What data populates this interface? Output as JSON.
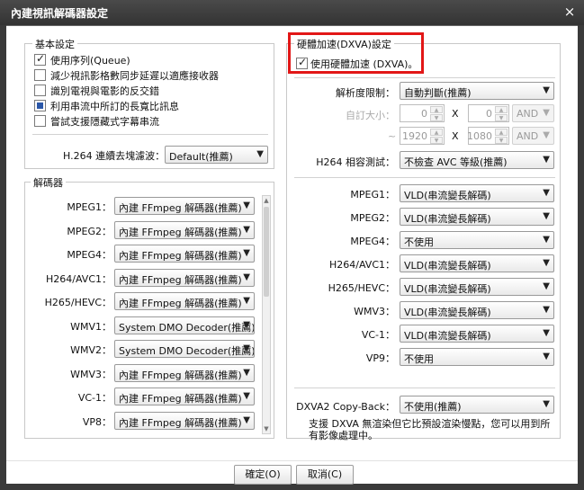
{
  "window": {
    "title": "內建視訊解碼器設定",
    "close_glyph": "×"
  },
  "basic": {
    "legend": "基本設定",
    "items": [
      {
        "label": "使用序列(Queue)",
        "state": "checked"
      },
      {
        "label": "減少視訊影格數同步延遲以適應接收器",
        "state": "unchecked"
      },
      {
        "label": "識別電視與電影的反交錯",
        "state": "unchecked"
      },
      {
        "label": "利用串流中所訂的長寬比訊息",
        "state": "indeterminate"
      },
      {
        "label": "嘗試支援隱藏式字幕串流",
        "state": "unchecked"
      }
    ],
    "deblock_label": "H.264 連續去塊濾波：",
    "deblock_value": "Default(推薦)"
  },
  "decoder": {
    "legend": "解碼器",
    "rows": [
      {
        "label": "MPEG1：",
        "value": "內建 FFmpeg 解碼器(推薦)"
      },
      {
        "label": "MPEG2：",
        "value": "內建 FFmpeg 解碼器(推薦)"
      },
      {
        "label": "MPEG4：",
        "value": "內建 FFmpeg 解碼器(推薦)"
      },
      {
        "label": "H264/AVC1：",
        "value": "內建 FFmpeg 解碼器(推薦)"
      },
      {
        "label": "H265/HEVC：",
        "value": "內建 FFmpeg 解碼器(推薦)"
      },
      {
        "label": "WMV1：",
        "value": "System DMO Decoder(推薦)"
      },
      {
        "label": "WMV2：",
        "value": "System DMO Decoder(推薦)"
      },
      {
        "label": "WMV3：",
        "value": "內建 FFmpeg 解碼器(推薦)"
      },
      {
        "label": "VC-1：",
        "value": "內建 FFmpeg 解碼器(推薦)"
      },
      {
        "label": "VP8：",
        "value": "內建 FFmpeg 解碼器(推薦)"
      }
    ]
  },
  "dxva": {
    "legend": "硬體加速(DXVA)設定",
    "enable_label": "使用硬體加速 (DXVA)。",
    "resolution_label": "解析度限制：",
    "resolution_value": "自動判斷(推薦)",
    "custom_size_label": "自訂大小：",
    "min_w": "0",
    "min_h": "0",
    "min_op": "AND",
    "tilde": "~",
    "max_w": "1920",
    "max_h": "1080",
    "max_op": "AND",
    "x_sep": "X",
    "compat_label": "H264 相容測試：",
    "compat_value": "不檢查 AVC 等級(推薦)",
    "codecs": [
      {
        "label": "MPEG1：",
        "value": "VLD(串流變長解碼)"
      },
      {
        "label": "MPEG2：",
        "value": "VLD(串流變長解碼)"
      },
      {
        "label": "MPEG4：",
        "value": "不使用"
      },
      {
        "label": "H264/AVC1：",
        "value": "VLD(串流變長解碼)"
      },
      {
        "label": "H265/HEVC：",
        "value": "VLD(串流變長解碼)"
      },
      {
        "label": "WMV3：",
        "value": "VLD(串流變長解碼)"
      },
      {
        "label": "VC-1：",
        "value": "VLD(串流變長解碼)"
      },
      {
        "label": "VP9：",
        "value": "不使用"
      }
    ],
    "copyback_label": "DXVA2 Copy-Back：",
    "copyback_value": "不使用(推薦)",
    "note": "支援 DXVA 無渲染但它比預設渲染慢點，您可以用到所有影像處理中。"
  },
  "buttons": {
    "ok": "確定(O)",
    "cancel": "取消(C)"
  },
  "colors": {
    "highlight": "#e21717",
    "titlebar": "#3a3a3a"
  }
}
